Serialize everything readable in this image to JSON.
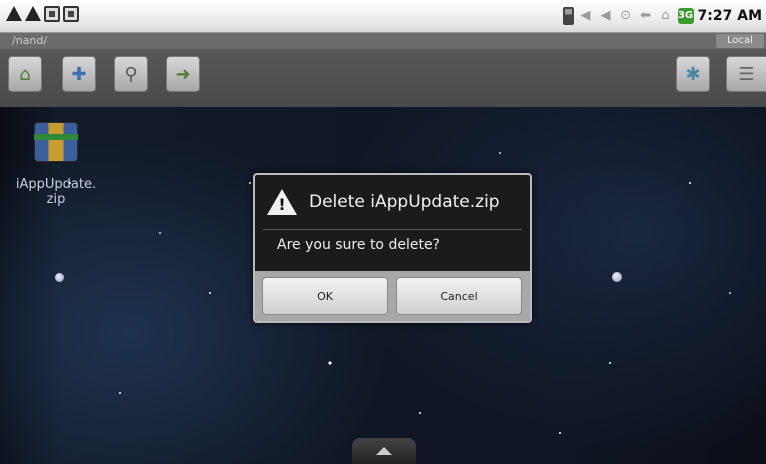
{
  "status_bar": {
    "time": "7:27 AM",
    "battery_label": "3G"
  },
  "file_manager": {
    "path": "/nand/",
    "storage_button": "Local"
  },
  "toolbar": {
    "icons": [
      "home-icon",
      "new-folder-icon",
      "search-icon",
      "move-icon",
      "settings-icon",
      "list-view-icon"
    ]
  },
  "desktop": {
    "file": {
      "name": "iAppUpdate.\nzip",
      "icon": "zip-archive-icon"
    }
  },
  "dialog": {
    "title": "Delete iAppUpdate.zip",
    "message": "Are you sure to delete?",
    "ok_label": "OK",
    "cancel_label": "Cancel",
    "icon": "warning-icon"
  },
  "colors": {
    "dialog_background": "#1b1b1b",
    "button_bar": "#a8a8a8",
    "toolbar": "#4a4a4a"
  }
}
